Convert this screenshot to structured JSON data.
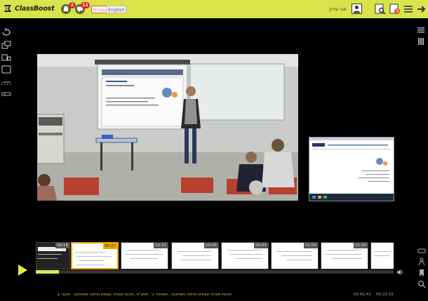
{
  "app": {
    "logo_text": "ClassBoost"
  },
  "header": {
    "notifications": {
      "count": "2"
    },
    "messages": {
      "count": "11"
    },
    "languages": [
      {
        "label": "עברית"
      },
      {
        "label": "English"
      }
    ],
    "user_name": "אבי עירון"
  },
  "thumbnails": [
    {
      "time": "00:16"
    },
    {
      "time": "00:27"
    },
    {
      "time": "00:31"
    },
    {
      "time": "00:45"
    },
    {
      "time": "00:55"
    },
    {
      "time": "01:04"
    },
    {
      "time": "01:24"
    },
    {
      "time": ""
    }
  ],
  "player": {
    "progress": 0.064,
    "elapsed": "00:01:41",
    "total": "00:22:15"
  },
  "caption": "תכנות מונחה עצמים ופיתוח משחקים , סמסטר ב', תשע\"ח, תכנות מונחה עצמים ופיתוח משחקים - שיעור 1",
  "colors": {
    "accent": "#d9e34a",
    "active_thumb": "#f0a400",
    "badge": "#e02323"
  }
}
